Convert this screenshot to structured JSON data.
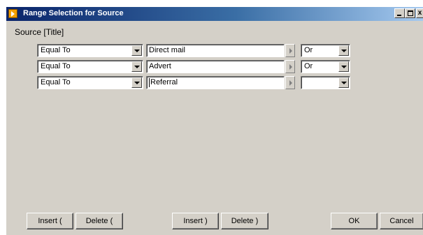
{
  "window": {
    "title": "Range Selection for Source",
    "colors": {
      "titlebar_start": "#0a246a",
      "titlebar_end": "#a6caf0",
      "face": "#d4d0c8"
    },
    "controls": {
      "minimize": "minimize-icon",
      "maximize": "maximize-icon",
      "close": "close-icon",
      "close_label": "x"
    }
  },
  "heading": "Source [Title]",
  "rows": [
    {
      "operator": "Equal To",
      "value": "Direct mail",
      "connector": "Or"
    },
    {
      "operator": "Equal To",
      "value": "Advert",
      "connector": "Or"
    },
    {
      "operator": "Equal To",
      "value": "Referral",
      "connector": ""
    }
  ],
  "buttons": {
    "insert_open": "Insert (",
    "delete_open": "Delete (",
    "insert_close": "Insert )",
    "delete_close": "Delete )",
    "ok": "OK",
    "cancel": "Cancel"
  }
}
